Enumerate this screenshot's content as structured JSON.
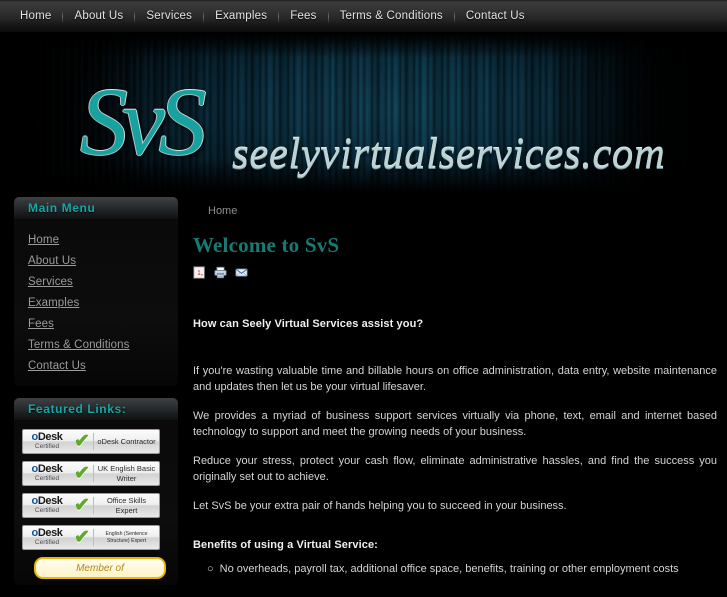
{
  "topnav": {
    "items": [
      {
        "label": "Home"
      },
      {
        "label": "About Us"
      },
      {
        "label": "Services"
      },
      {
        "label": "Examples"
      },
      {
        "label": "Fees"
      },
      {
        "label": "Terms & Conditions"
      },
      {
        "label": "Contact Us"
      }
    ]
  },
  "banner": {
    "logo_mark": "SvS",
    "logo_text": "seelyvirtualservices.com",
    "accent_teal": "#17a2a0",
    "background": "#07222f"
  },
  "sidebar": {
    "main_menu": {
      "title": "Main Menu",
      "items": [
        {
          "label": "Home"
        },
        {
          "label": "About Us"
        },
        {
          "label": "Services"
        },
        {
          "label": "Examples"
        },
        {
          "label": "Fees"
        },
        {
          "label": "Terms & Conditions"
        },
        {
          "label": "Contact Us"
        }
      ]
    },
    "featured_links": {
      "title": "Featured Links:",
      "badges": [
        {
          "brand": "Desk",
          "brand_initial": "o",
          "certified": "Certified",
          "check": "✔",
          "title": "oDesk Contractor"
        },
        {
          "brand": "Desk",
          "brand_initial": "o",
          "certified": "Certified",
          "check": "✔",
          "title": "UK English Basic Writer"
        },
        {
          "brand": "Desk",
          "brand_initial": "o",
          "certified": "Certified",
          "check": "✔",
          "title": "Office Skills Expert"
        },
        {
          "brand": "Desk",
          "brand_initial": "o",
          "certified": "Certified",
          "check": "✔",
          "title": "English (Sentence Structure) Expert"
        }
      ],
      "gold_button_label": "Member of"
    }
  },
  "content": {
    "breadcrumb": "Home",
    "title": "Welcome to SvS",
    "tools": [
      {
        "name": "pdf-icon",
        "label": "PDF"
      },
      {
        "name": "print-icon",
        "label": "Print"
      },
      {
        "name": "email-icon",
        "label": "E-mail"
      }
    ],
    "heading_how": "How can Seely Virtual Services assist you?",
    "paragraph_1": "If you're wasting valuable time and billable hours on office administration, data entry, website maintenance and updates then let us be your virtual lifesaver.",
    "paragraph_2": "We provides a myriad of business support services virtually via phone, text, email and internet based technology to support and meet the growing needs of your business.",
    "paragraph_3": "Reduce your stress, protect your cash flow, eliminate administrative hassles, and find the success you originally set out to achieve.",
    "paragraph_4": "Let SvS be your extra pair of hands helping you to succeed in your business.",
    "heading_benefits": "Benefits of using a Virtual Service:",
    "bullet_dot": "○",
    "bullet_1": "No overheads, payroll tax, additional office space, benefits, training or other employment costs"
  }
}
